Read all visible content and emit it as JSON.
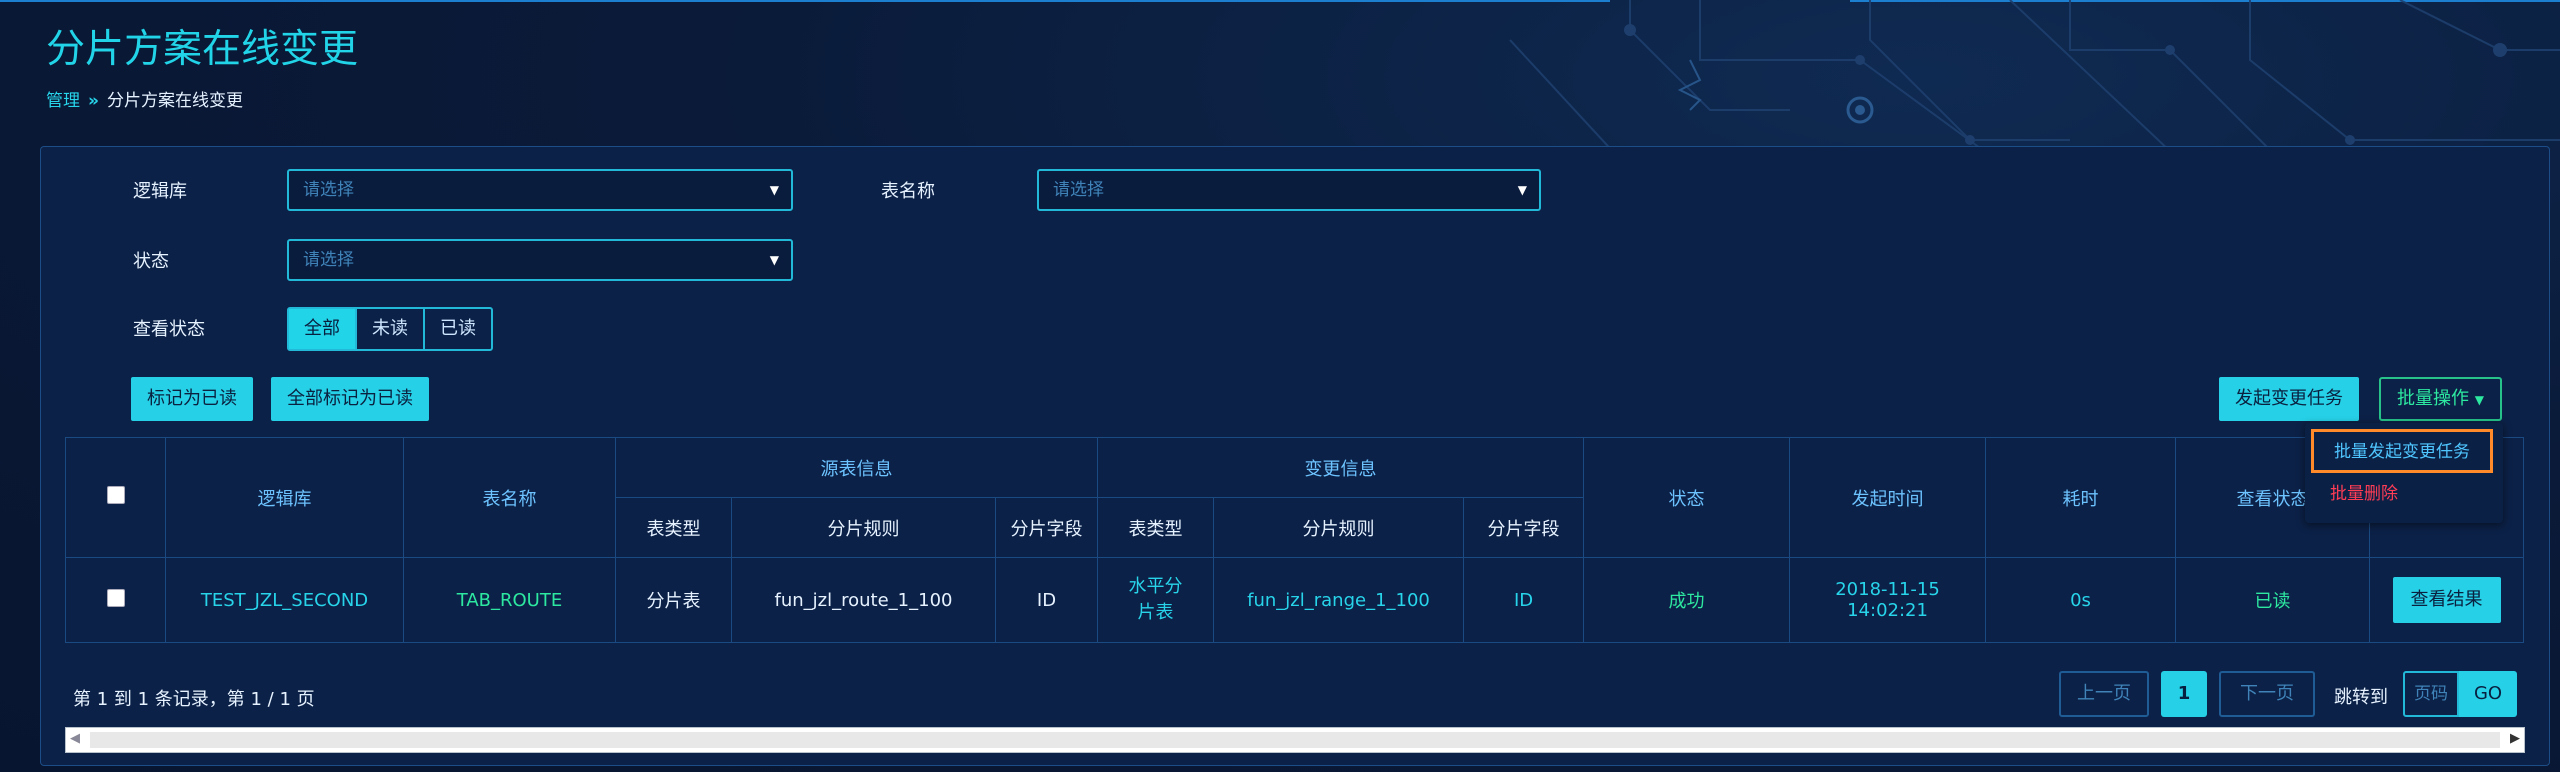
{
  "page": {
    "title": "分片方案在线变更",
    "breadcrumb": {
      "parent": "管理",
      "separator": "»",
      "current": "分片方案在线变更"
    }
  },
  "filters": {
    "logic_db": {
      "label": "逻辑库",
      "placeholder": "请选择"
    },
    "table_name": {
      "label": "表名称",
      "placeholder": "请选择"
    },
    "status": {
      "label": "状态",
      "placeholder": "请选择"
    },
    "view_status": {
      "label": "查看状态",
      "options": [
        "全部",
        "未读",
        "已读"
      ],
      "selected": "全部"
    }
  },
  "toolbar": {
    "mark_read": "标记为已读",
    "mark_all_read": "全部标记为已读",
    "start_task": "发起变更任务",
    "batch": "批量操作",
    "batch_menu": [
      "批量发起变更任务",
      "批量删除"
    ]
  },
  "table": {
    "headers": {
      "logic_db": "逻辑库",
      "table_name": "表名称",
      "source_group": "源表信息",
      "change_group": "变更信息",
      "table_type": "表类型",
      "shard_rule": "分片规则",
      "shard_field": "分片字段",
      "status": "状态",
      "start_time": "发起时间",
      "duration": "耗时",
      "view_status": "查看状态"
    },
    "rows": [
      {
        "logic_db": "TEST_JZL_SECOND",
        "table_name": "TAB_ROUTE",
        "src_type": "分片表",
        "src_rule": "fun_jzl_route_1_100",
        "src_field": "ID",
        "dst_type": "水平分片表",
        "dst_rule": "fun_jzl_range_1_100",
        "dst_field": "ID",
        "status": "成功",
        "start_date": "2018-11-15",
        "start_time": "14:02:21",
        "duration": "0s",
        "view_status": "已读",
        "action": "查看结果"
      }
    ]
  },
  "pagination": {
    "summary": "第 1 到 1 条记录，第 1 / 1 页",
    "prev": "上一页",
    "current": "1",
    "next": "下一页",
    "jump_label": "跳转到",
    "page_input_placeholder": "页码",
    "go": "GO"
  },
  "scrollbar": {
    "left_arrow": "◀",
    "right_arrow": "▶"
  },
  "colors": {
    "accent": "#26d0e6",
    "success": "#2de8a0",
    "danger": "#ff3d55",
    "highlight": "#ff8a2a"
  }
}
